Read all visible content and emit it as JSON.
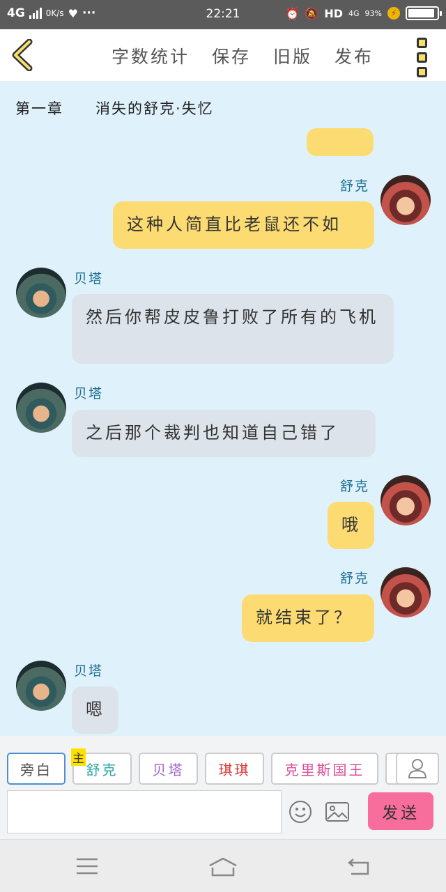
{
  "status_bar": {
    "network": "4G",
    "speed": "0K/s",
    "time": "22:21",
    "hd": "HD",
    "lte": "4G",
    "battery": "93%",
    "battery_level": 0.93
  },
  "header": {
    "menu": [
      "字数统计",
      "保存",
      "旧版",
      "发布"
    ]
  },
  "chapter": {
    "number": "第一章",
    "title": "消失的舒克·失忆"
  },
  "messages": [
    {
      "name": "舒克",
      "text": "这种人简直比老鼠还不如"
    },
    {
      "name": "贝塔",
      "text": "然后你帮皮皮鲁打败了所有的飞机"
    },
    {
      "name": "贝塔",
      "text": "之后那个裁判也知道自己错了"
    },
    {
      "name": "舒克",
      "text": "哦"
    },
    {
      "name": "舒克",
      "text": "就结束了？"
    },
    {
      "name": "贝塔",
      "text": "嗯"
    }
  ],
  "roles": {
    "narrator": "旁白",
    "main_badge": "主",
    "shuke": "舒克",
    "beita": "贝塔",
    "qiqi": "琪琪",
    "king": "克里斯国王"
  },
  "composer": {
    "placeholder": "",
    "send": "发送"
  },
  "colors": {
    "background": "#dff1fb",
    "my_bubble": "#fcdc72",
    "other_bubble": "#dde3ea",
    "send_button": "#f76d9c",
    "name": "#1e6f93"
  }
}
